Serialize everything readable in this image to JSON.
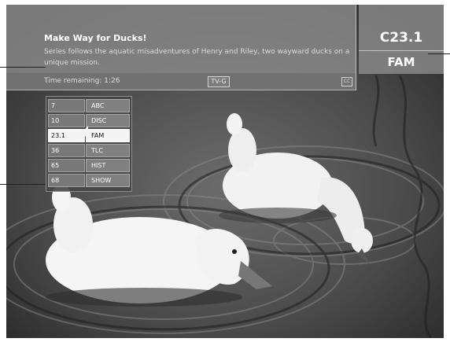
{
  "info_banner": {
    "title": "Make Way for Ducks!",
    "description": "Series follows the aquatic misadventures of Henry and Riley, two wayward ducks on a unique mission.",
    "time_remaining": "Time remaining: 1:26",
    "rating": "TV-G",
    "cc_icon": "closed-captions-icon"
  },
  "channel": {
    "number": "C23.1",
    "name": "FAM"
  },
  "channel_list": {
    "selected_index": 2,
    "rows": [
      {
        "number": "7",
        "name": "ABC"
      },
      {
        "number": "10",
        "name": "DISC"
      },
      {
        "number": "23.1",
        "name": "FAM"
      },
      {
        "number": "36",
        "name": "TLC"
      },
      {
        "number": "65",
        "name": "HIST"
      },
      {
        "number": "68",
        "name": "SHOW"
      }
    ]
  },
  "colors": {
    "overlay": "#878787",
    "selected_row": "#f4f4f4",
    "text": "#ffffff"
  }
}
